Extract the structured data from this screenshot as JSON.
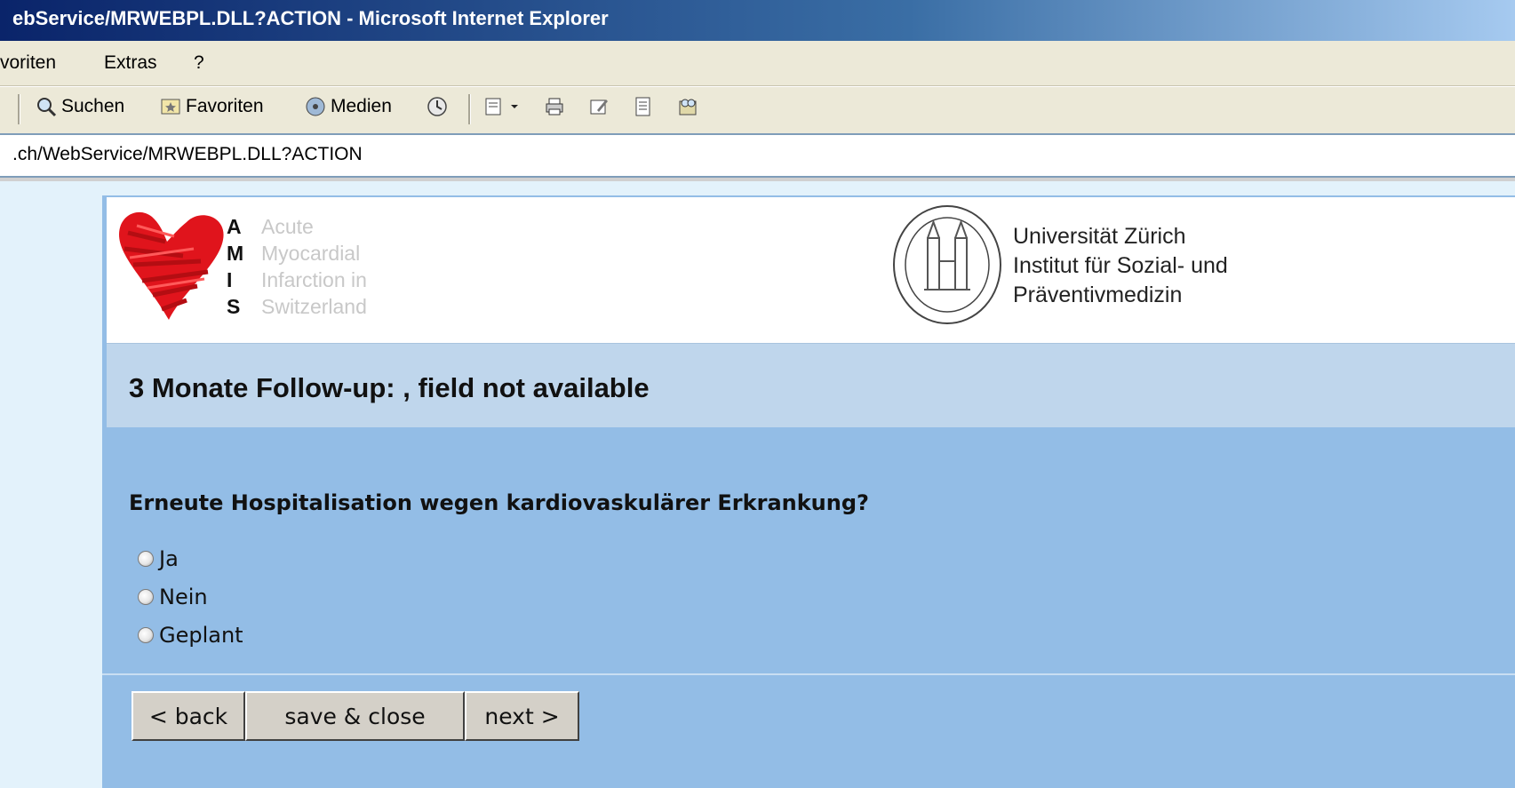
{
  "window": {
    "title": "ebService/MRWEBPL.DLL?ACTION - Microsoft Internet Explorer"
  },
  "menu": {
    "items": [
      "voriten",
      "Extras",
      "?"
    ]
  },
  "toolbar": {
    "search_label": "Suchen",
    "favorites_label": "Favoriten",
    "media_label": "Medien"
  },
  "address": {
    "url": ".ch/WebService/MRWEBPL.DLL?ACTION"
  },
  "header": {
    "amis_letters": [
      "A",
      "M",
      "I",
      "S"
    ],
    "amis_words": [
      "Acute",
      "Myocardial",
      "Infarction  in",
      "Switzerland"
    ],
    "university_lines": [
      "Universität Zürich",
      "Institut für Sozial- und",
      "Präventivmedizin"
    ]
  },
  "page": {
    "title": "3 Monate Follow-up: , field not available"
  },
  "form": {
    "question": "Erneute Hospitalisation wegen kardiovaskulärer Erkrankung?",
    "options": [
      "Ja",
      "Nein",
      "Geplant"
    ]
  },
  "buttons": {
    "back": "< back",
    "save_close": "save & close",
    "next": "next >"
  },
  "colors": {
    "panel": "#93bde6",
    "title_bar": "#bfd6ec",
    "heart": "#e0141c"
  }
}
